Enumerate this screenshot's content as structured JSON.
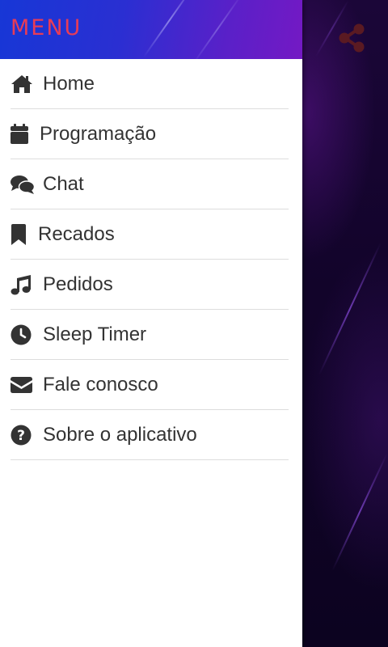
{
  "drawer": {
    "title": "MENU",
    "items": [
      {
        "label": "Home",
        "icon": "home-icon"
      },
      {
        "label": "Programação",
        "icon": "calendar-icon"
      },
      {
        "label": "Chat",
        "icon": "chat-icon"
      },
      {
        "label": "Recados",
        "icon": "bookmark-icon"
      },
      {
        "label": "Pedidos",
        "icon": "music-icon"
      },
      {
        "label": "Sleep Timer",
        "icon": "clock-icon"
      },
      {
        "label": "Fale conosco",
        "icon": "envelope-icon"
      },
      {
        "label": "Sobre o aplicativo",
        "icon": "question-circle-icon"
      }
    ]
  },
  "app": {
    "share_icon": "share-icon"
  },
  "colors": {
    "title": "#e83c57",
    "header_start": "#1737d6",
    "header_end": "#7419c4",
    "icon": "#333333",
    "share_icon": "#5a1a22"
  }
}
